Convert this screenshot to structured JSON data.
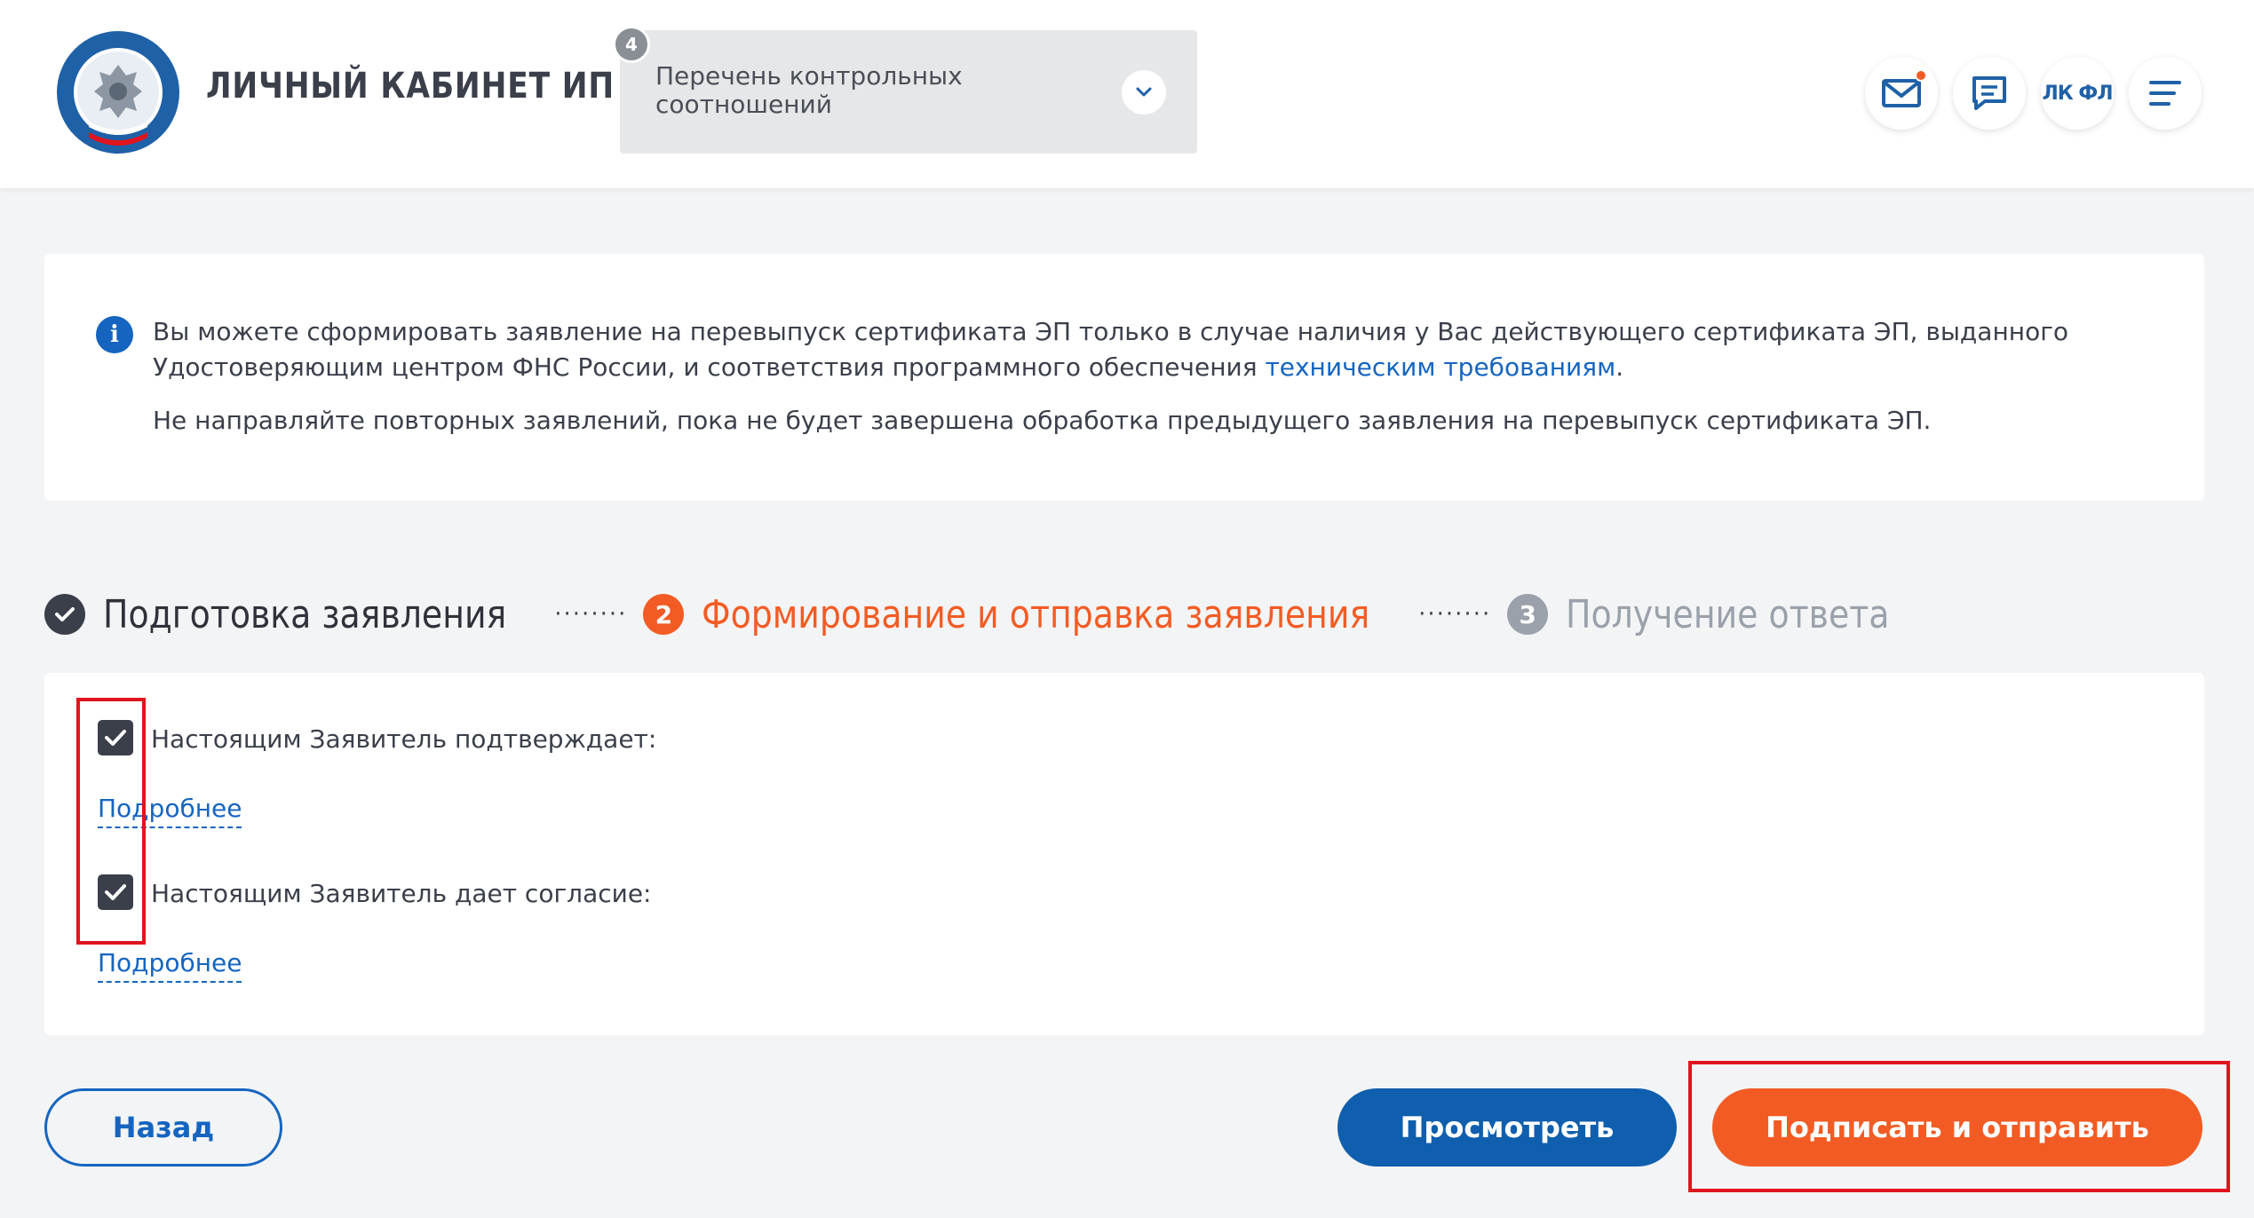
{
  "header": {
    "brand": "ЛИЧНЫЙ КАБИНЕТ ИП",
    "dropdown": {
      "badge": "4",
      "label": "Перечень контрольных соотношений"
    },
    "buttons": {
      "lkfl": "ЛК ФЛ"
    }
  },
  "info": {
    "text_before_link": "Вы можете сформировать заявление на перевыпуск сертификата ЭП только в случае наличия у Вас действующего сертификата ЭП, выданного Удостоверяющим центром ФНС России, и соответствия программного обеспечения ",
    "link": "техническим требованиям",
    "text_after_link": ".",
    "note": "Не направляйте повторных заявлений, пока не будет завершена обработка предыдущего заявления на перевыпуск сертификата ЭП."
  },
  "stepper": {
    "steps": [
      {
        "label": "Подготовка заявления",
        "state": "done",
        "number": ""
      },
      {
        "label": "Формирование и отправка заявления",
        "state": "active",
        "number": "2"
      },
      {
        "label": "Получение ответа",
        "state": "todo",
        "number": "3"
      }
    ]
  },
  "consent": {
    "items": [
      {
        "label": "Настоящим Заявитель подтверждает:",
        "checked": true,
        "more": "Подробнее"
      },
      {
        "label": "Настоящим Заявитель дает согласие:",
        "checked": true,
        "more": "Подробнее"
      }
    ]
  },
  "actions": {
    "back": "Назад",
    "preview": "Просмотреть",
    "sign": "Подписать и отправить"
  },
  "colors": {
    "accent_orange": "#f25c24",
    "primary_blue": "#0f5fae",
    "link_blue": "#1565c0",
    "highlight_red": "#e0141e"
  }
}
